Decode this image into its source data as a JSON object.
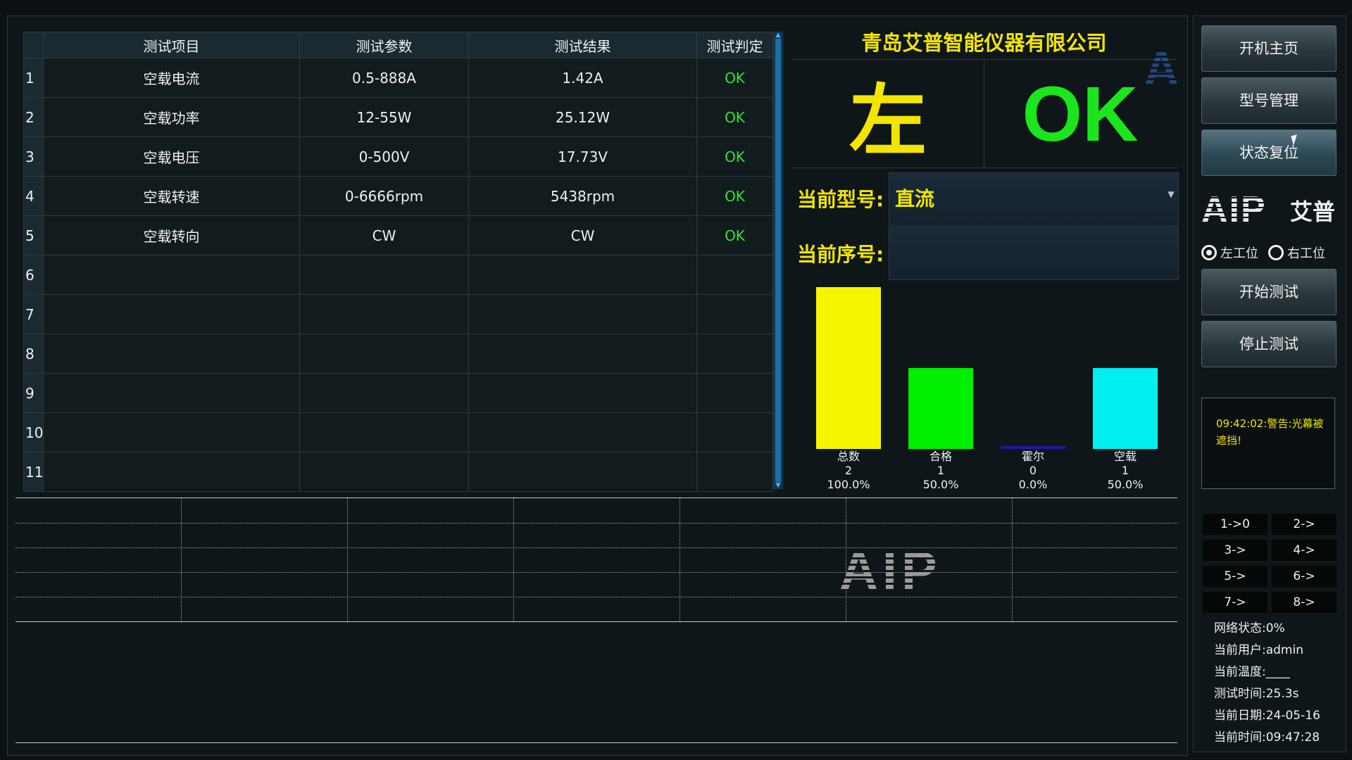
{
  "table": {
    "headers": [
      "",
      "测试项目",
      "测试参数",
      "测试结果",
      "测试判定"
    ],
    "rows": [
      {
        "idx": "1",
        "item": "空载电流",
        "param": "0.5-888A",
        "result": "1.42A",
        "judge": "OK"
      },
      {
        "idx": "2",
        "item": "空载功率",
        "param": "12-55W",
        "result": "25.12W",
        "judge": "OK"
      },
      {
        "idx": "3",
        "item": "空载电压",
        "param": "0-500V",
        "result": "17.73V",
        "judge": "OK"
      },
      {
        "idx": "4",
        "item": "空载转速",
        "param": "0-6666rpm",
        "result": "5438rpm",
        "judge": "OK"
      },
      {
        "idx": "5",
        "item": "空载转向",
        "param": "CW",
        "result": "CW",
        "judge": "OK"
      },
      {
        "idx": "6",
        "item": "",
        "param": "",
        "result": "",
        "judge": ""
      },
      {
        "idx": "7",
        "item": "",
        "param": "",
        "result": "",
        "judge": ""
      },
      {
        "idx": "8",
        "item": "",
        "param": "",
        "result": "",
        "judge": ""
      },
      {
        "idx": "9",
        "item": "",
        "param": "",
        "result": "",
        "judge": ""
      },
      {
        "idx": "10",
        "item": "",
        "param": "",
        "result": "",
        "judge": ""
      },
      {
        "idx": "11",
        "item": "",
        "param": "",
        "result": "",
        "judge": ""
      }
    ]
  },
  "status": {
    "company": "青岛艾普智能仪器有限公司",
    "side": "左",
    "result": "OK",
    "model_label": "当前型号:",
    "model_value": "直流",
    "serial_label": "当前序号:",
    "serial_value": ""
  },
  "chart_data": {
    "type": "bar",
    "categories": [
      "总数",
      "合格",
      "霍尔",
      "空载"
    ],
    "values": [
      2,
      1,
      0,
      1
    ],
    "percents": [
      "100.0%",
      "50.0%",
      "0.0%",
      "50.0%"
    ],
    "colors": [
      "#f5f500",
      "#00f000",
      "#1a1aa0",
      "#00f0f0"
    ],
    "ylim": [
      0,
      2
    ]
  },
  "watermark": "AIP",
  "sidebar": {
    "buttons": [
      "开机主页",
      "型号管理",
      "状态复位"
    ],
    "logo_text": "AIP",
    "logo_cn": "艾普",
    "radio_left": "左工位",
    "radio_right": "右工位",
    "start_test": "开始测试",
    "stop_test": "停止测试",
    "message": "09:42:02:警告:光幕被遮挡!",
    "nav": [
      "1->0",
      "2->",
      "3->",
      "4->",
      "5->",
      "6->",
      "7->",
      "8->"
    ],
    "status": [
      "网络状态:0%",
      "当前用户:admin",
      "当前温度:____",
      "测试时间:25.3s",
      "当前日期:24-05-16",
      "当前时间:09:47:28"
    ]
  }
}
